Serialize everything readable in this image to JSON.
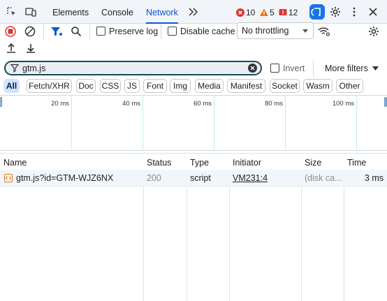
{
  "tabs": [
    {
      "label": "Elements",
      "active": false
    },
    {
      "label": "Console",
      "active": false
    },
    {
      "label": "Network",
      "active": true
    }
  ],
  "badges": {
    "errors": "10",
    "warnings": "5",
    "issues": "12"
  },
  "toolbar": {
    "preserve_log_label": "Preserve log",
    "disable_cache_label": "Disable cache",
    "throttling_value": "No throttling"
  },
  "filter": {
    "value": "gtm.js",
    "invert_label": "Invert",
    "more_filters_label": "More filters"
  },
  "type_filters": [
    "All",
    "Fetch/XHR",
    "Doc",
    "CSS",
    "JS",
    "Font",
    "Img",
    "Media",
    "Manifest",
    "Socket",
    "Wasm",
    "Other"
  ],
  "overview": {
    "ticks": [
      "20 ms",
      "40 ms",
      "60 ms",
      "80 ms",
      "100 ms"
    ]
  },
  "table": {
    "columns": [
      "Name",
      "Status",
      "Type",
      "Initiator",
      "Size",
      "Time"
    ],
    "rows": [
      {
        "name": "gtm.js?id=GTM-WJZ6NX",
        "status": "200",
        "type": "script",
        "initiator": "VM231:4",
        "size": "(disk ca...",
        "time": "3 ms"
      }
    ]
  },
  "colors": {
    "accent": "#0b57d0",
    "error": "#dc362e",
    "warning": "#e8710a",
    "record_stop": "#dc362e"
  }
}
